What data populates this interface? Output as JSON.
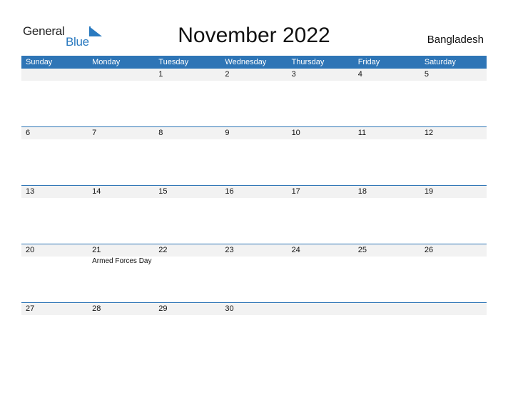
{
  "logo": {
    "general": "General",
    "blue": "Blue",
    "icon": "triangle-flag-icon"
  },
  "header": {
    "title": "November 2022",
    "country": "Bangladesh"
  },
  "colors": {
    "accent": "#2e75b6",
    "row_bg": "#f2f2f2"
  },
  "weekdays": [
    "Sunday",
    "Monday",
    "Tuesday",
    "Wednesday",
    "Thursday",
    "Friday",
    "Saturday"
  ],
  "weeks": [
    {
      "days": [
        "",
        "",
        "1",
        "2",
        "3",
        "4",
        "5"
      ],
      "events": [
        "",
        "",
        "",
        "",
        "",
        "",
        ""
      ]
    },
    {
      "days": [
        "6",
        "7",
        "8",
        "9",
        "10",
        "11",
        "12"
      ],
      "events": [
        "",
        "",
        "",
        "",
        "",
        "",
        ""
      ]
    },
    {
      "days": [
        "13",
        "14",
        "15",
        "16",
        "17",
        "18",
        "19"
      ],
      "events": [
        "",
        "",
        "",
        "",
        "",
        "",
        ""
      ]
    },
    {
      "days": [
        "20",
        "21",
        "22",
        "23",
        "24",
        "25",
        "26"
      ],
      "events": [
        "",
        "Armed Forces Day",
        "",
        "",
        "",
        "",
        ""
      ]
    },
    {
      "days": [
        "27",
        "28",
        "29",
        "30",
        "",
        "",
        ""
      ],
      "events": [
        "",
        "",
        "",
        "",
        "",
        "",
        ""
      ]
    }
  ]
}
